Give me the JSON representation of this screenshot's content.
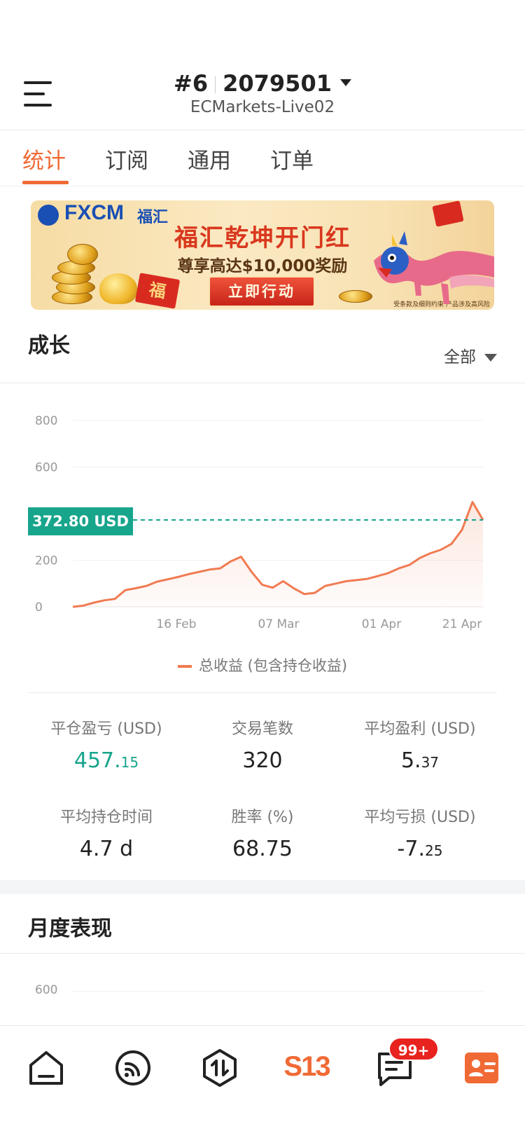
{
  "header": {
    "account_index": "#6",
    "account_number": "2079501",
    "server": "ECMarkets-Live02"
  },
  "tabs": [
    {
      "label": "统计",
      "active": true
    },
    {
      "label": "订阅",
      "active": false
    },
    {
      "label": "通用",
      "active": false
    },
    {
      "label": "订单",
      "active": false
    }
  ],
  "banner": {
    "logo": "FXCM",
    "logo_cn": "福汇",
    "headline": "福汇乾坤开门红",
    "subline": "尊享高达$10,000奖励",
    "cta": "立即行动",
    "disclaimer": "受条款及细则约束  产品涉及高风险",
    "envelope_char": "福"
  },
  "growth": {
    "title": "成长",
    "filter": "全部",
    "current_value_label": "372.80 USD",
    "legend": "总收益 (包含持仓收益)"
  },
  "chart_data": {
    "type": "area",
    "x_ticks": [
      "16 Feb",
      "07 Mar",
      "01 Apr",
      "21 Apr"
    ],
    "y_ticks": [
      0,
      200,
      600,
      800
    ],
    "ylim": [
      0,
      800
    ],
    "reference_line": 372.8,
    "series": [
      {
        "name": "总收益 (包含持仓收益)",
        "color": "#f07b52",
        "values": [
          0,
          5,
          18,
          28,
          34,
          72,
          80,
          90,
          108,
          118,
          128,
          140,
          150,
          160,
          165,
          195,
          215,
          150,
          95,
          82,
          110,
          80,
          55,
          60,
          90,
          100,
          110,
          115,
          120,
          132,
          145,
          165,
          180,
          210,
          230,
          245,
          270,
          330,
          450,
          372.8
        ]
      }
    ]
  },
  "stats": [
    {
      "label": "平仓盈亏 (USD)",
      "int": "457.",
      "dec": "15",
      "color": "#17a58c"
    },
    {
      "label": "交易笔数",
      "int": "320",
      "dec": ""
    },
    {
      "label": "平均盈利 (USD)",
      "int": "5.",
      "dec": "37"
    },
    {
      "label": "平均持仓时间",
      "int": "4.7 d",
      "dec": ""
    },
    {
      "label": "胜率 (%)",
      "int": "68.75",
      "dec": ""
    },
    {
      "label": "平均亏损 (USD)",
      "int": "-7.",
      "dec": "25"
    }
  ],
  "monthly": {
    "title": "月度表现",
    "y_tick": "600"
  },
  "bottom_nav": {
    "items": [
      "home-icon",
      "feed-icon",
      "trade-icon",
      "s13-logo",
      "messages-icon",
      "profile-card-icon"
    ],
    "logo_text": "S13",
    "badge": "99+",
    "accent": "#f06a35"
  }
}
